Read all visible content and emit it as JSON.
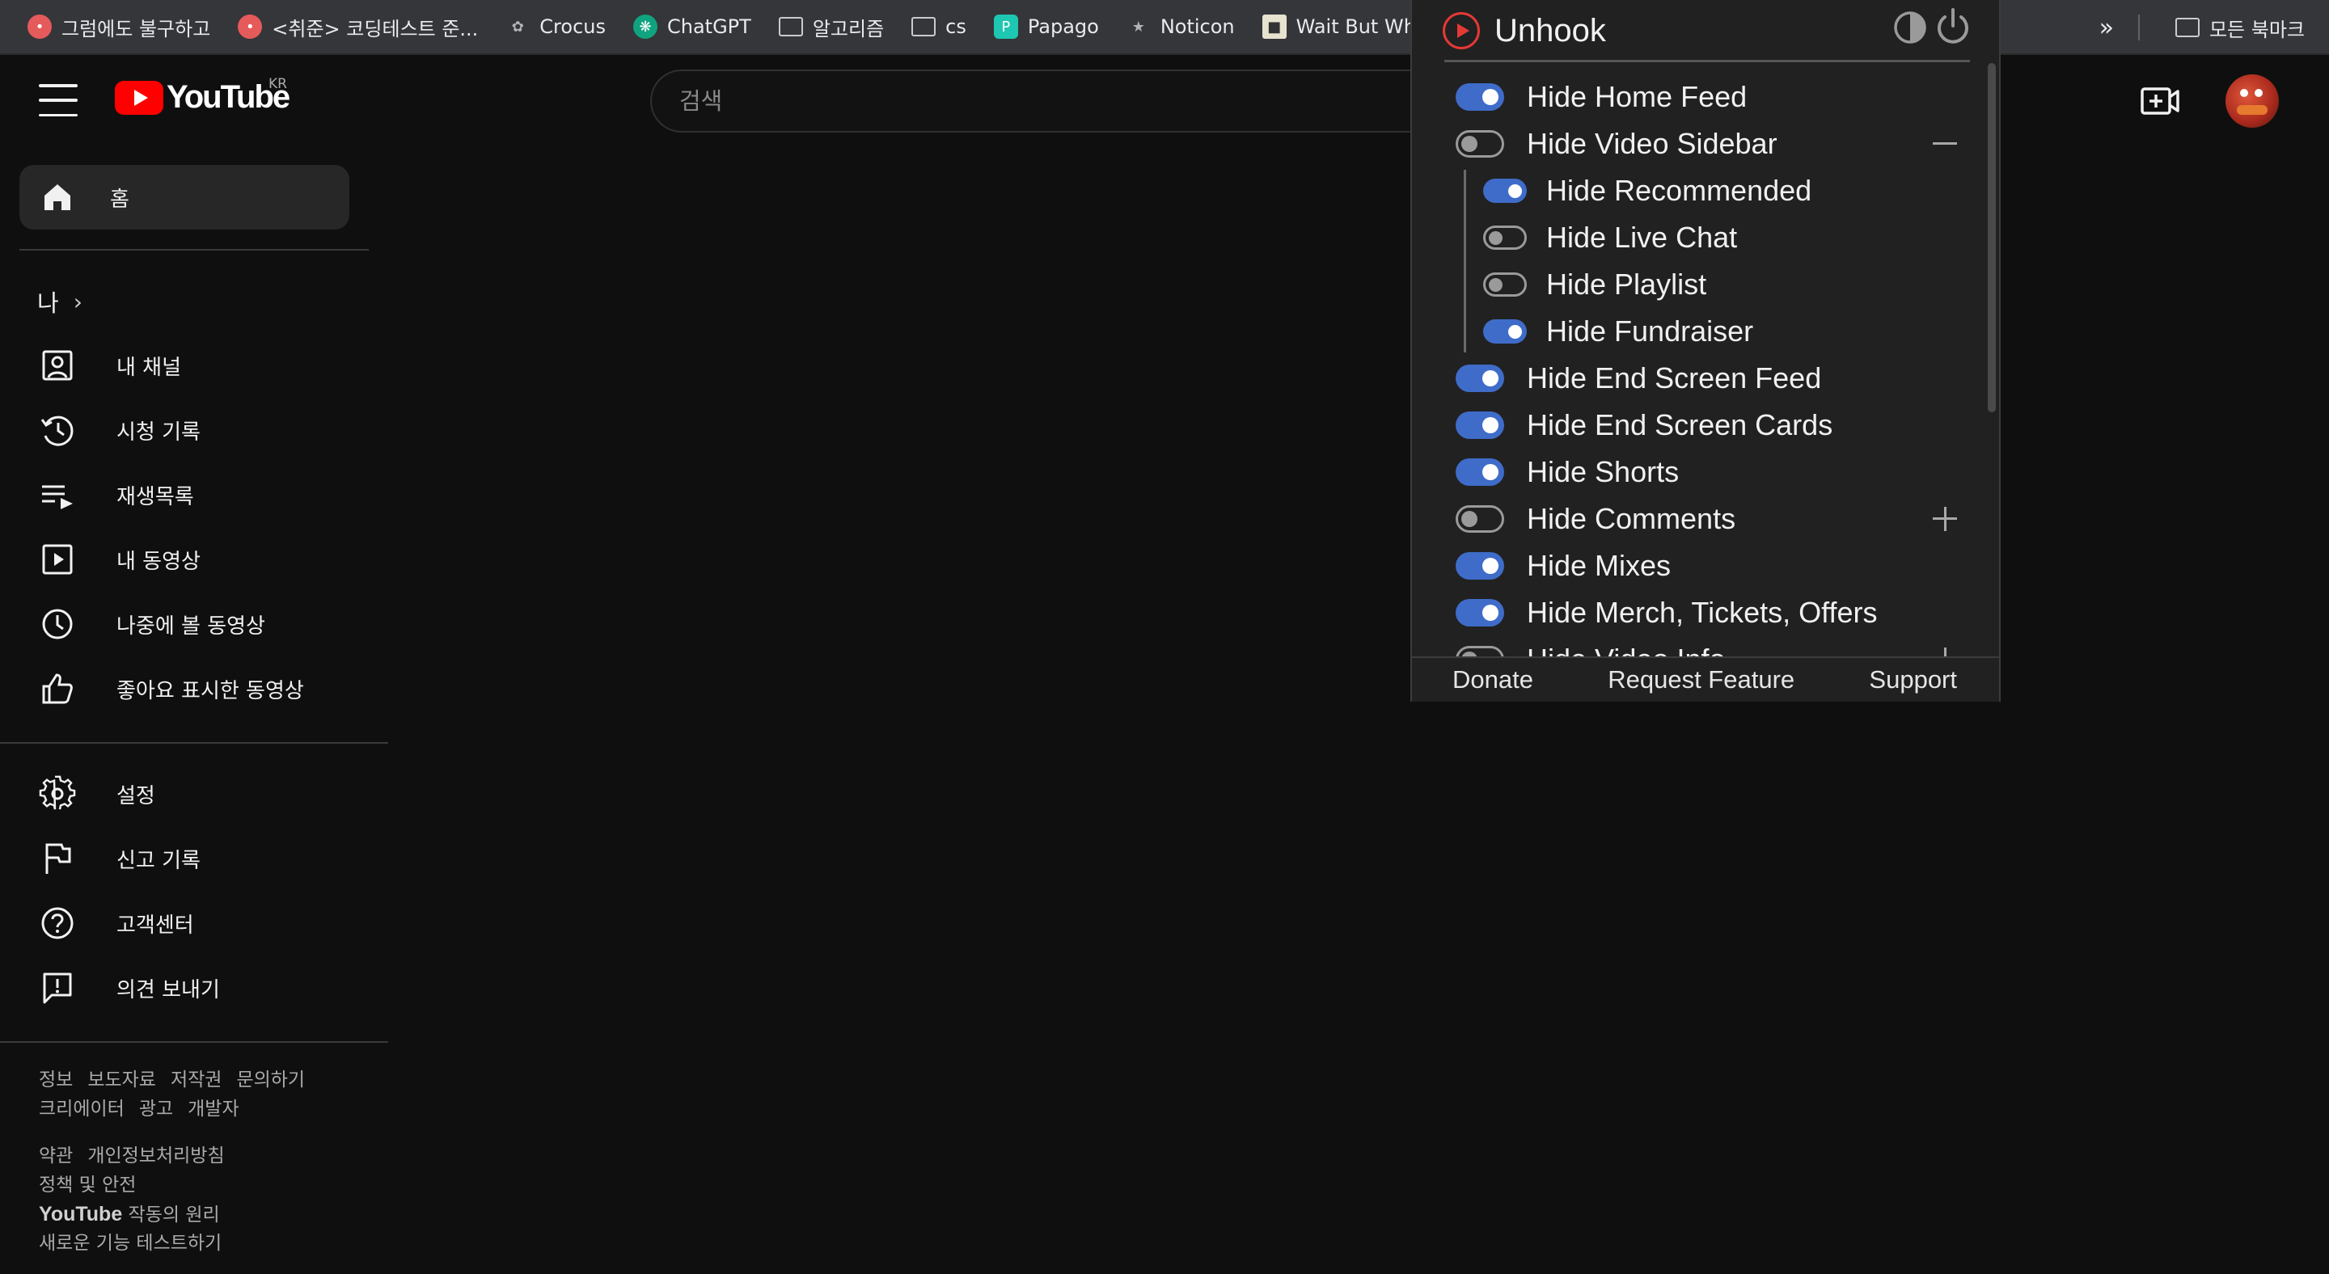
{
  "bookmarks": {
    "items": [
      {
        "label": "그럼에도 불구하고",
        "icon": "red-circle-icon"
      },
      {
        "label": "<취준> 코딩테스트 준...",
        "icon": "red-circle-icon"
      },
      {
        "label": "Crocus",
        "icon": "crocus-icon"
      },
      {
        "label": "ChatGPT",
        "icon": "chatgpt-icon"
      },
      {
        "label": "알고리즘",
        "icon": "folder-icon"
      },
      {
        "label": "cs",
        "icon": "folder-icon"
      },
      {
        "label": "Papago",
        "icon": "papago-icon"
      },
      {
        "label": "Noticon",
        "icon": "noticon-icon"
      },
      {
        "label": "Wait But Why",
        "icon": "waitbutwhy-icon"
      }
    ],
    "overflow_icon": "chevron-double-right-icon",
    "all_bookmarks_label": "모든 북마크"
  },
  "header": {
    "logo_text": "YouTube",
    "region": "KR",
    "search_placeholder": "검색"
  },
  "sidebar": {
    "home_label": "홈",
    "you_label": "나",
    "you_items": [
      {
        "label": "내 채널",
        "icon": "person-box-icon"
      },
      {
        "label": "시청 기록",
        "icon": "history-icon"
      },
      {
        "label": "재생목록",
        "icon": "playlist-icon"
      },
      {
        "label": "내 동영상",
        "icon": "play-box-icon"
      },
      {
        "label": "나중에 볼 동영상",
        "icon": "clock-icon"
      },
      {
        "label": "좋아요 표시한 동영상",
        "icon": "thumbs-up-icon"
      }
    ],
    "settings_items": [
      {
        "label": "설정",
        "icon": "gear-icon"
      },
      {
        "label": "신고 기록",
        "icon": "flag-icon"
      },
      {
        "label": "고객센터",
        "icon": "help-icon"
      },
      {
        "label": "의견 보내기",
        "icon": "feedback-icon"
      }
    ],
    "footer": {
      "row1": [
        "정보",
        "보도자료",
        "저작권",
        "문의하기"
      ],
      "row2": [
        "크리에이터",
        "광고",
        "개발자"
      ],
      "row3": [
        "약관",
        "개인정보처리방침"
      ],
      "row4": "정책 및 안전",
      "row5_strong": "YouTube",
      "row5_rest": " 작동의 원리",
      "row6": "새로운 기능 테스트하기"
    }
  },
  "unhook": {
    "title": "Unhook",
    "options": [
      {
        "label": "Hide Home Feed",
        "on": true
      },
      {
        "label": "Hide Video Sidebar",
        "on": false,
        "expander": "minus"
      },
      {
        "label": "Hide Recommended",
        "on": true,
        "sub": true
      },
      {
        "label": "Hide Live Chat",
        "on": false,
        "sub": true
      },
      {
        "label": "Hide Playlist",
        "on": false,
        "sub": true
      },
      {
        "label": "Hide Fundraiser",
        "on": true,
        "sub": true
      },
      {
        "label": "Hide End Screen Feed",
        "on": true
      },
      {
        "label": "Hide End Screen Cards",
        "on": true
      },
      {
        "label": "Hide Shorts",
        "on": true
      },
      {
        "label": "Hide Comments",
        "on": false,
        "expander": "plus"
      },
      {
        "label": "Hide Mixes",
        "on": true
      },
      {
        "label": "Hide Merch, Tickets, Offers",
        "on": true
      },
      {
        "label": "Hide Video Info",
        "on": false,
        "expander": "plus"
      }
    ],
    "footer": {
      "donate": "Donate",
      "request": "Request Feature",
      "support": "Support"
    },
    "toggle_on_color": "#3f6cc9",
    "brand_color": "#e53935"
  }
}
